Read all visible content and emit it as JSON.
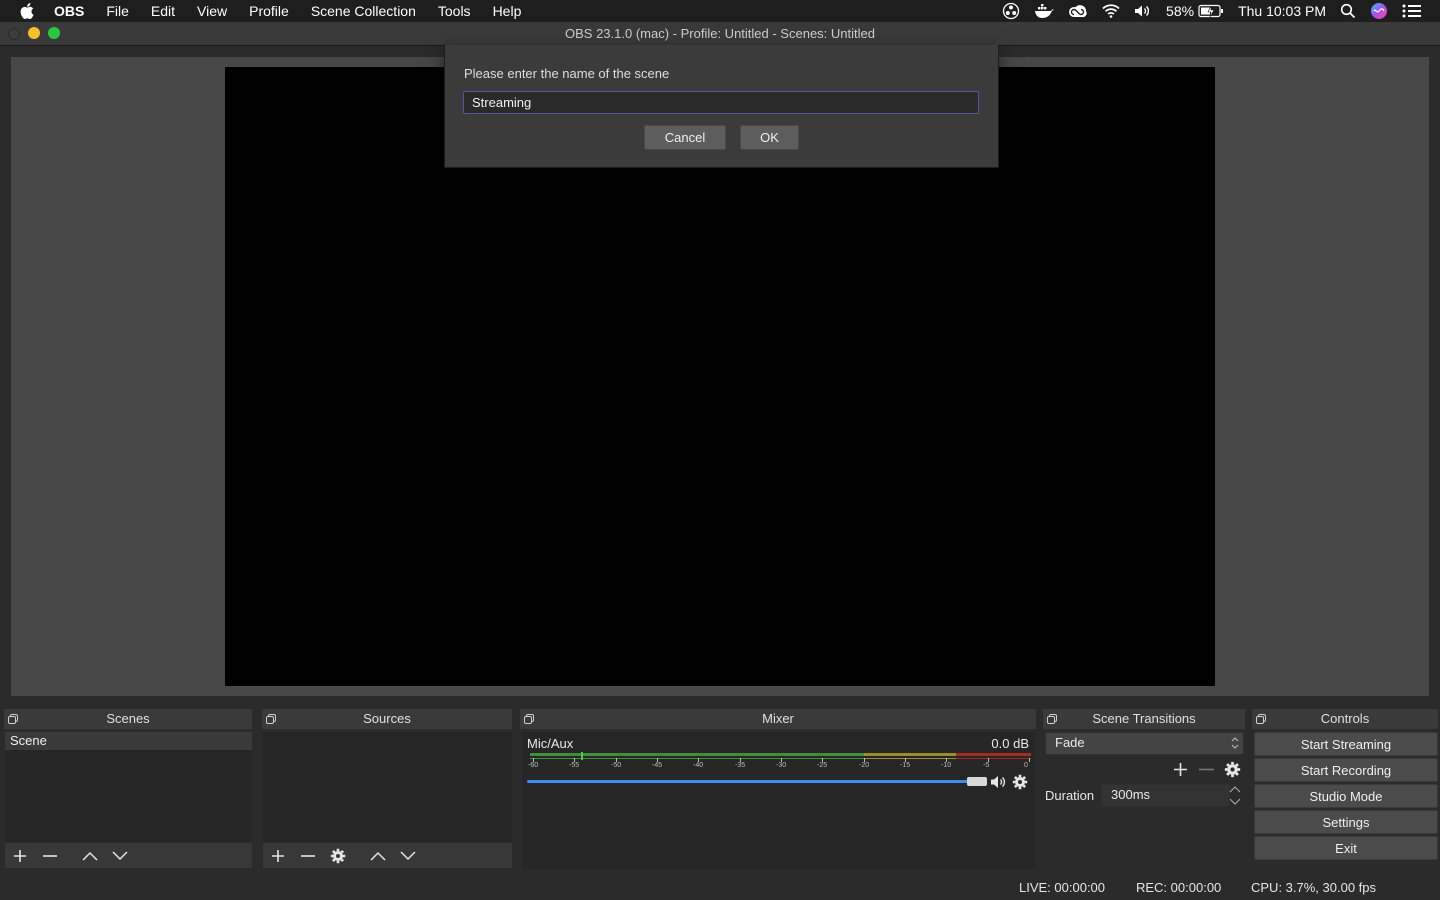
{
  "menubar": {
    "app": "OBS",
    "menus": [
      "File",
      "Edit",
      "View",
      "Profile",
      "Scene Collection",
      "Tools",
      "Help"
    ],
    "battery": "58%",
    "clock": "Thu 10:03 PM"
  },
  "window": {
    "title": "OBS 23.1.0 (mac) - Profile: Untitled - Scenes: Untitled"
  },
  "dialog": {
    "prompt": "Please enter the name of the scene",
    "input_value": "Streaming",
    "cancel_label": "Cancel",
    "ok_label": "OK"
  },
  "docks": {
    "scenes": {
      "title": "Scenes",
      "items": [
        "Scene"
      ]
    },
    "sources": {
      "title": "Sources"
    },
    "mixer": {
      "title": "Mixer",
      "channel": "Mic/Aux",
      "level": "0.0 dB",
      "ticks": [
        "-60",
        "-55",
        "-50",
        "-45",
        "-40",
        "-35",
        "-30",
        "-25",
        "-20",
        "-15",
        "-10",
        "-5",
        "0"
      ],
      "volume_fraction": 1.0
    },
    "transitions": {
      "title": "Scene Transitions",
      "selected": "Fade",
      "duration_label": "Duration",
      "duration_value": "300ms"
    },
    "controls": {
      "title": "Controls",
      "buttons": [
        "Start Streaming",
        "Start Recording",
        "Studio Mode",
        "Settings",
        "Exit"
      ]
    }
  },
  "statusbar": {
    "live": "LIVE: 00:00:00",
    "rec": "REC: 00:00:00",
    "cpu": "CPU: 3.7%, 30.00 fps"
  },
  "colors": {
    "accent": "#4f5b9c",
    "meter_green": "#4caf50",
    "meter_yellow": "#b8a93a",
    "meter_red": "#c0392b",
    "slider_blue": "#3d8cf0"
  }
}
